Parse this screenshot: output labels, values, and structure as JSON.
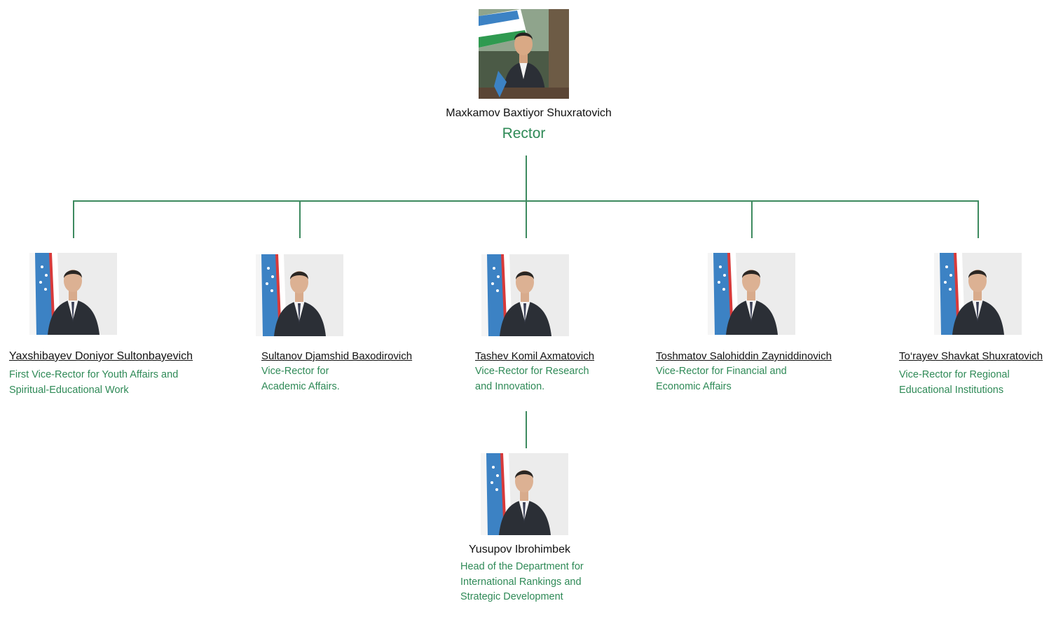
{
  "colors": {
    "accent": "#2f8a57",
    "line": "#3d8a5f",
    "text": "#111111"
  },
  "rector": {
    "name": "Maxkamov Baxtiyor Shuxratovich",
    "role": "Rector",
    "photo_icon": "rector-portrait"
  },
  "vice_rectors": [
    {
      "name": "Yaxshibayev Doniyor Sultonbayevich",
      "role": "First Vice-Rector for Youth Affairs and\nSpiritual-Educational Work"
    },
    {
      "name": "Sultanov Djamshid Baxodirovich",
      "role": "Vice-Rector for\nAcademic Affairs."
    },
    {
      "name": "Tashev Komil Axmatovich",
      "role": "Vice-Rector for Research\nand Innovation."
    },
    {
      "name": "Toshmatov Salohiddin Zayniddinovich",
      "role": "Vice-Rector for Financial and\nEconomic Affairs"
    },
    {
      "name": "To‘rayev Shavkat Shuxratovich",
      "role": "Vice-Rector for Regional\nEducational Institutions"
    }
  ],
  "department_head": {
    "name": "Yusupov Ibrohimbek",
    "role": "Head of the Department for\nInternational Rankings and\nStrategic Development"
  }
}
